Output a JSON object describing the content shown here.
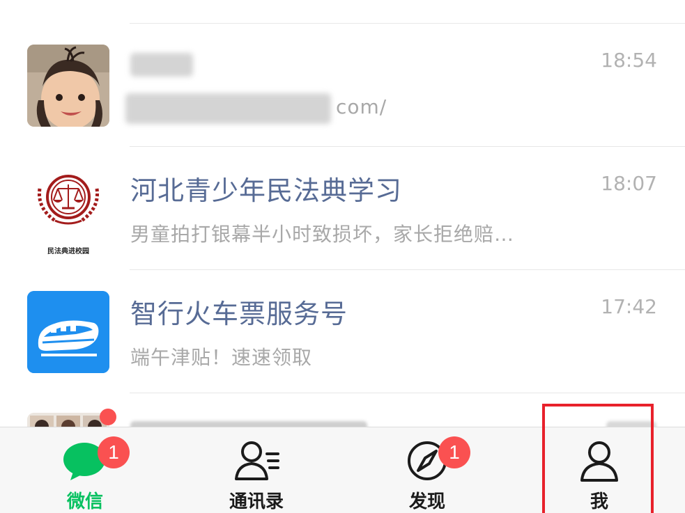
{
  "chats": [
    {
      "title": "",
      "preview": "com/",
      "time": "18:54",
      "avatar": "child-photo"
    },
    {
      "title": "河北青少年民法典学习",
      "preview": "男童拍打银幕半小时致损坏，家长拒绝赔…",
      "time": "18:07",
      "avatar": "civil-code-logo",
      "avatar_caption": "民法典进校园"
    },
    {
      "title": "智行火车票服务号",
      "preview": "端午津贴！速速领取",
      "time": "17:42",
      "avatar": "train-logo"
    },
    {
      "title": "",
      "preview": "",
      "time": "",
      "avatar": "group-photo"
    }
  ],
  "tabbar": {
    "tabs": [
      {
        "label": "微信",
        "icon": "chat-bubble-icon",
        "badge": "1",
        "active": true
      },
      {
        "label": "通讯录",
        "icon": "contacts-icon",
        "badge": "",
        "active": false
      },
      {
        "label": "发现",
        "icon": "compass-icon",
        "badge": "1",
        "active": false
      },
      {
        "label": "我",
        "icon": "person-icon",
        "badge": "",
        "active": false
      }
    ]
  },
  "colors": {
    "accent": "#07c160",
    "badge": "#fa5151",
    "title": "#576b95",
    "preview": "#a8a8a8",
    "highlight": "#e8212b"
  }
}
